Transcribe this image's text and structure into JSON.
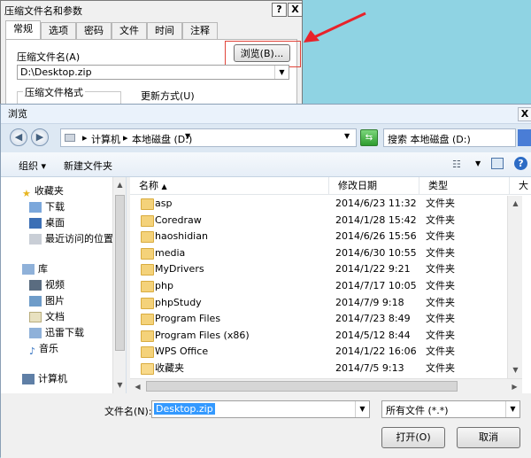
{
  "back_dialog": {
    "title": "压缩文件名和参数",
    "help_btn": "?",
    "close_btn": "X",
    "tabs": [
      "常规",
      "选项",
      "密码",
      "文件",
      "时间",
      "注释"
    ],
    "archive_name_label": "压缩文件名(A)",
    "browse_btn": "浏览(B)...",
    "archive_name_value": "D:\\Desktop.zip",
    "format_label": "压缩文件格式",
    "update_label": "更新方式(U)"
  },
  "front_dialog": {
    "title": "浏览",
    "close_btn": "X",
    "breadcrumb": [
      "计算机",
      "本地磁盘 (D:)"
    ],
    "search_placeholder": "搜索 本地磁盘 (D:)",
    "toolbar": {
      "organize": "组织 ▾",
      "new_folder": "新建文件夹"
    },
    "nav": {
      "favorites": "收藏夹",
      "favorites_items": [
        "下载",
        "桌面",
        "最近访问的位置"
      ],
      "libraries": "库",
      "libraries_items": [
        "视频",
        "图片",
        "文档",
        "迅雷下载",
        "音乐"
      ],
      "computer": "计算机"
    },
    "columns": [
      "名称",
      "修改日期",
      "类型",
      "大"
    ],
    "files": [
      {
        "name": "asp",
        "date": "2014/6/23 11:32",
        "type": "文件夹"
      },
      {
        "name": "Coredraw",
        "date": "2014/1/28 15:42",
        "type": "文件夹"
      },
      {
        "name": "haoshidian",
        "date": "2014/6/26 15:56",
        "type": "文件夹"
      },
      {
        "name": "media",
        "date": "2014/6/30 10:55",
        "type": "文件夹"
      },
      {
        "name": "MyDrivers",
        "date": "2014/1/22 9:21",
        "type": "文件夹"
      },
      {
        "name": "php",
        "date": "2014/7/17 10:05",
        "type": "文件夹"
      },
      {
        "name": "phpStudy",
        "date": "2014/7/9 9:18",
        "type": "文件夹"
      },
      {
        "name": "Program Files",
        "date": "2014/7/23 8:49",
        "type": "文件夹"
      },
      {
        "name": "Program Files (x86)",
        "date": "2014/5/12 8:44",
        "type": "文件夹"
      },
      {
        "name": "WPS Office",
        "date": "2014/1/22 16:06",
        "type": "文件夹"
      },
      {
        "name": "收藏夹",
        "date": "2014/7/5 9:13",
        "type": "文件夹"
      }
    ],
    "filename_label": "文件名(N):",
    "filename_value": "Desktop.zip",
    "filetype_value": "所有文件 (*.*)",
    "open_btn": "打开(O)",
    "cancel_btn": "取消"
  },
  "colors": {
    "arrow_red": "#e8222a",
    "highlight_border": "#e0443a",
    "selection": "#3399ff"
  }
}
